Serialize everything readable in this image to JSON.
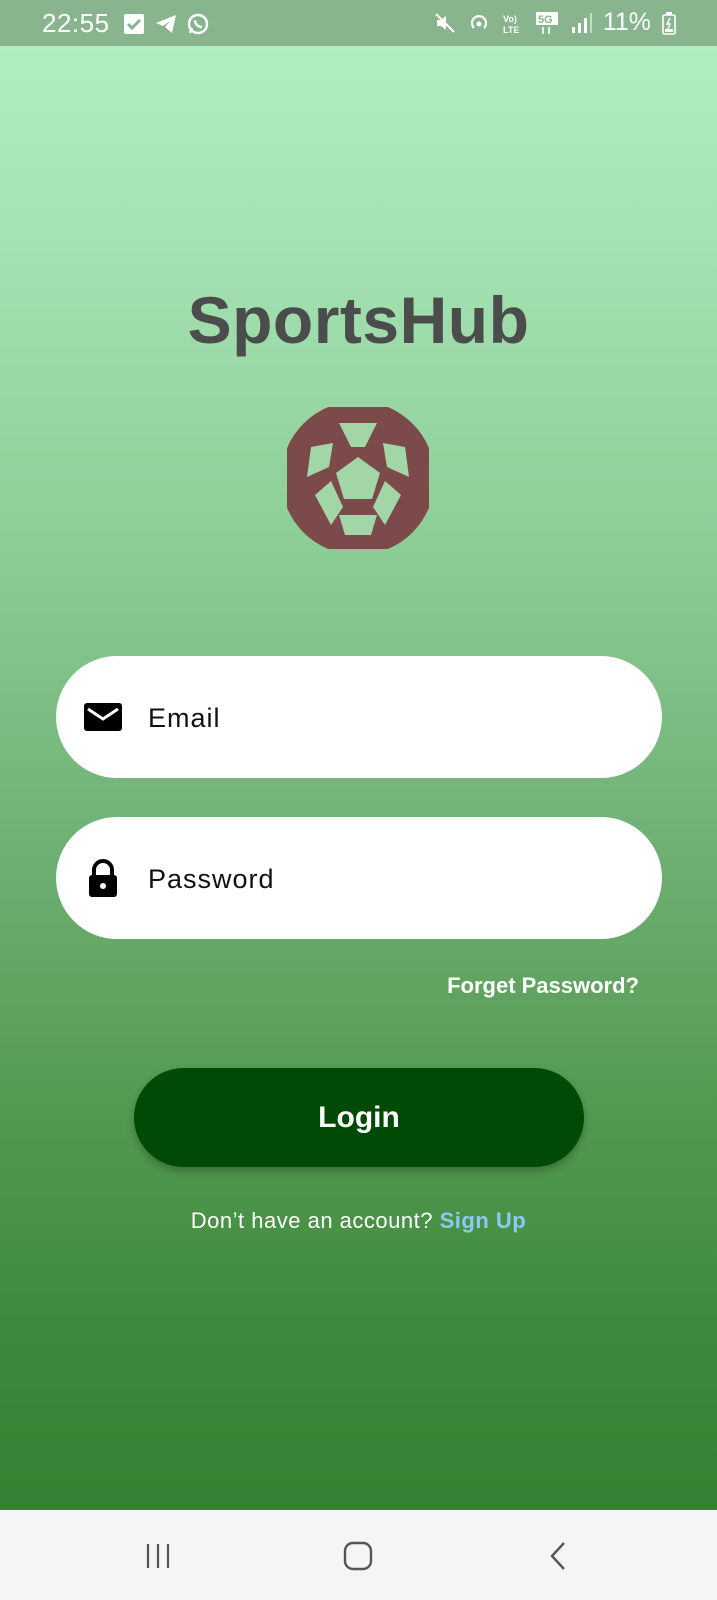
{
  "status_bar": {
    "time": "22:55",
    "battery_percent": "11%",
    "left_icons": [
      "checkbox-icon",
      "telegram-icon",
      "whatsapp-icon"
    ],
    "right_icons": [
      "mute-icon",
      "hotspot-icon",
      "volte-icon",
      "5g-icon",
      "signal-icon",
      "battery-charging-icon"
    ]
  },
  "app": {
    "title": "SportsHub",
    "logo_icon": "soccer-ball-icon",
    "logo_color": "#7d4a4c"
  },
  "form": {
    "email": {
      "placeholder": "Email",
      "value": "",
      "icon": "mail-icon"
    },
    "password": {
      "placeholder": "Password",
      "value": "",
      "icon": "lock-icon"
    },
    "forgot_label": "Forget Password?",
    "login_label": "Login",
    "signup_prompt": "Don’t have an account?",
    "signup_label": "Sign Up"
  },
  "colors": {
    "login_button": "#014a05",
    "signup_link": "#8ec9f5",
    "title_text": "#4a4d4b"
  },
  "nav_bar": {
    "buttons": [
      "recent-apps-icon",
      "home-icon",
      "back-icon"
    ]
  }
}
